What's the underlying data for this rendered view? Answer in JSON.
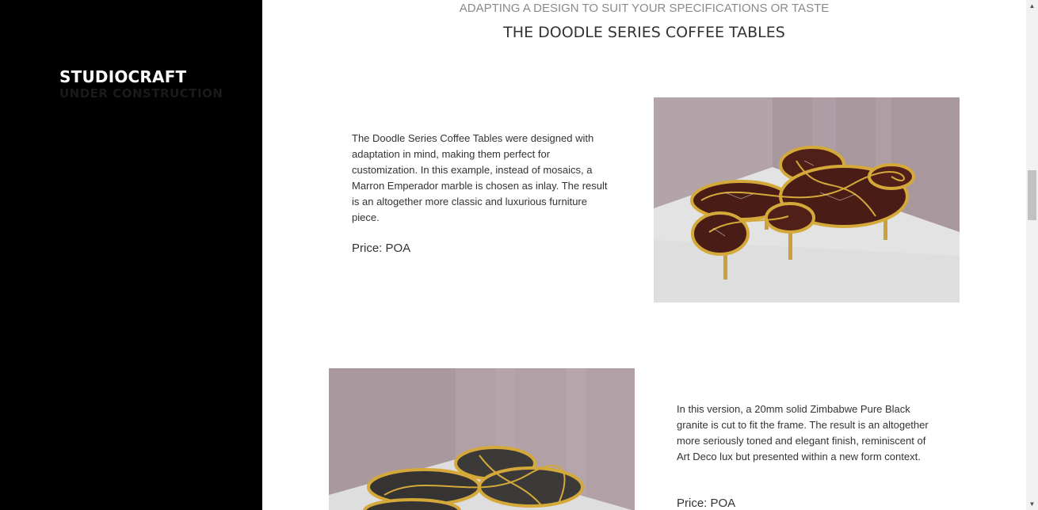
{
  "sidebar": {
    "brand": "STUDIOCRAFT",
    "subtitle": "UNDER CONSTRUCTION"
  },
  "header": {
    "kicker": "ADAPTING A DESIGN TO SUIT YOUR SPECIFICATIONS OR TASTE",
    "title": "THE DOODLE SERIES COFFEE TABLES"
  },
  "items": [
    {
      "description": "The Doodle Series Coffee Tables were designed with adaptation in mind, making them perfect for customization. In this example, instead of mosaics, a Marron Emperador marble is chosen as inlay. The result is an altogether more classic and luxurious furniture piece.",
      "price": "Price: POA",
      "image_icon": "marble-coffee-table-image"
    },
    {
      "description": "In this version, a 20mm solid Zimbabwe Pure Black granite is cut to fit the frame. The result is an altogether more seriously toned and elegant finish, reminiscent of Art Deco lux but presented within a new form context.",
      "price": "Price: POA",
      "image_icon": "granite-coffee-table-image"
    }
  ],
  "scrollbar": {
    "up_icon": "▲",
    "down_icon": "▼"
  },
  "colors": {
    "sidebar_bg": "#000000",
    "brand": "#ffffff",
    "gold": "#d4a93a",
    "marble_inlay": "#4a1c16",
    "granite_inlay": "#3b3a38"
  }
}
